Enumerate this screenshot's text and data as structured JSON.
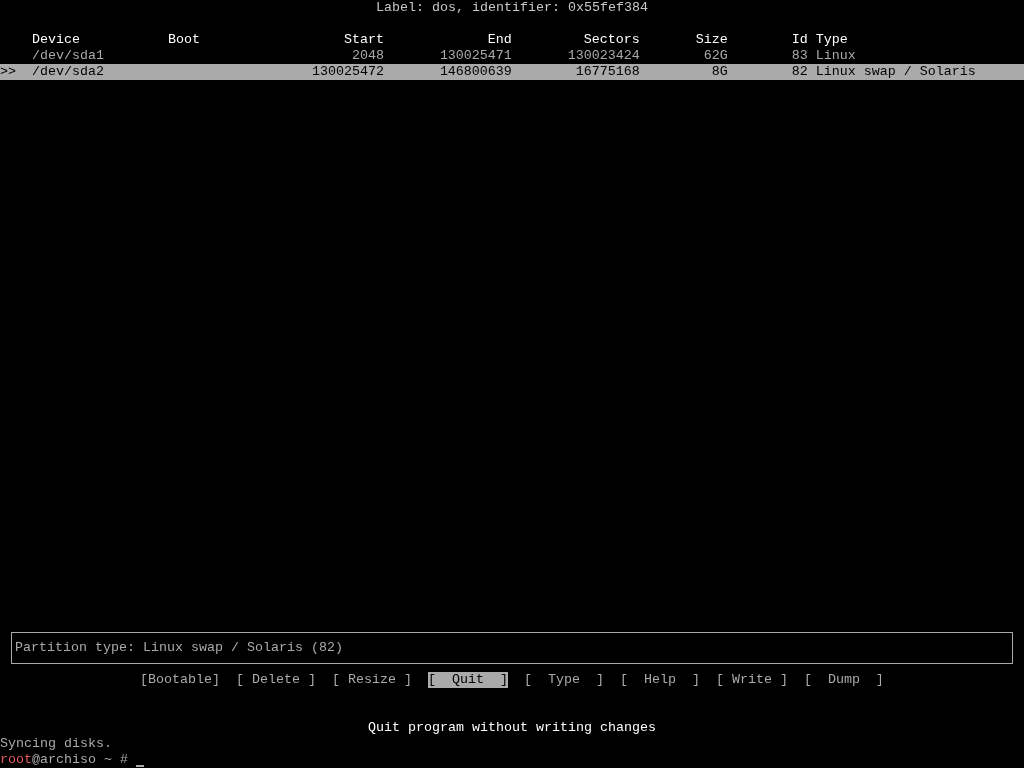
{
  "disk_label": "Label: dos, identifier: 0x55fef384",
  "table": {
    "columns": [
      "Device",
      "Boot",
      "Start",
      "End",
      "Sectors",
      "Size",
      "Id",
      "Type"
    ],
    "rows": [
      {
        "selected": false,
        "device": "/dev/sda1",
        "start": "2048",
        "end": "130025471",
        "sectors": "130023424",
        "size": "62G",
        "id": "83",
        "type": "Linux"
      },
      {
        "selected": true,
        "marker": ">>",
        "device": "/dev/sda2",
        "start": "130025472",
        "end": "146800639",
        "sectors": "16775168",
        "size": "8G",
        "id": "82",
        "type": "Linux swap / Solaris"
      }
    ]
  },
  "info_box": "Partition type: Linux swap / Solaris (82)",
  "menu": {
    "buttons": [
      {
        "label": "[Bootable]",
        "selected": false
      },
      {
        "label": "[ Delete ]",
        "selected": false
      },
      {
        "label": "[ Resize ]",
        "selected": false
      },
      {
        "label": "[  Quit  ]",
        "selected": true
      },
      {
        "label": "[  Type  ]",
        "selected": false
      },
      {
        "label": "[  Help  ]",
        "selected": false
      },
      {
        "label": "[ Write ]",
        "selected": false
      },
      {
        "label": "[  Dump  ]",
        "selected": false
      }
    ],
    "help": "Quit program without writing changes"
  },
  "shell": {
    "output": "Syncing disks.",
    "prompt_user": "root",
    "prompt_rest": "@archiso ~ #"
  }
}
